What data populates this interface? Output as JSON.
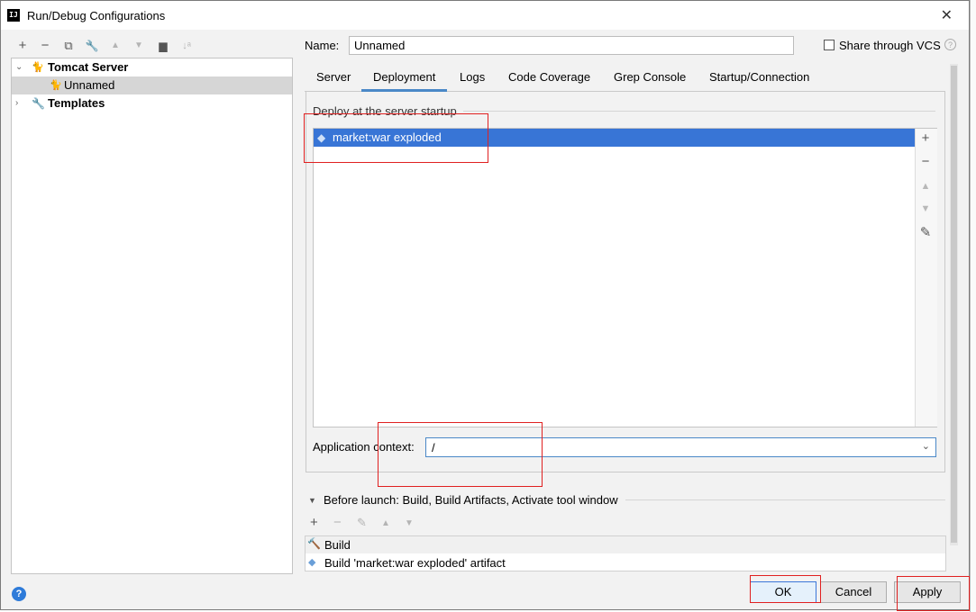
{
  "window": {
    "title": "Run/Debug Configurations",
    "app_icon_text": "IJ",
    "close_glyph": "✕"
  },
  "left_toolbar": {
    "icons": [
      "plus-icon",
      "minus-icon",
      "copy-icon",
      "wrench-icon",
      "arrow-up-icon",
      "arrow-down-icon",
      "folder-icon",
      "sort-icon"
    ],
    "glyphs": {
      "add": "+",
      "remove": "−",
      "copy": "⧉",
      "wrench": "🔧",
      "up": "▲",
      "down": "▼",
      "folder": "▆",
      "sort": "↓ᵃ"
    }
  },
  "tree": {
    "items": [
      {
        "label": "Tomcat Server",
        "expanded": true
      },
      {
        "label": "Unnamed"
      },
      {
        "label": "Templates",
        "expanded": false
      }
    ]
  },
  "name_field": {
    "label": "Name:",
    "value": "Unnamed"
  },
  "share": {
    "label": "Share through VCS",
    "checked": false,
    "help_glyph": "?"
  },
  "tabs": [
    {
      "label": "Server"
    },
    {
      "label": "Deployment",
      "active": true
    },
    {
      "label": "Logs"
    },
    {
      "label": "Code Coverage"
    },
    {
      "label": "Grep Console"
    },
    {
      "label": "Startup/Connection"
    }
  ],
  "deploy": {
    "section_label": "Deploy at the server startup",
    "items": [
      "market:war exploded"
    ],
    "side_glyphs": {
      "add": "+",
      "remove": "−",
      "up": "▲",
      "down": "▼",
      "edit": "✎"
    }
  },
  "app_context": {
    "label": "Application context:",
    "value": "/"
  },
  "before_launch": {
    "label": "Before launch: Build, Build Artifacts, Activate tool window",
    "items": [
      "Build",
      "Build 'market:war exploded' artifact"
    ]
  },
  "buttons": {
    "ok": "OK",
    "cancel": "Cancel",
    "apply": "Apply"
  },
  "colors": {
    "selection": "#3875d6",
    "annotation_red": "#e02020",
    "accent": "#4a88c7"
  }
}
